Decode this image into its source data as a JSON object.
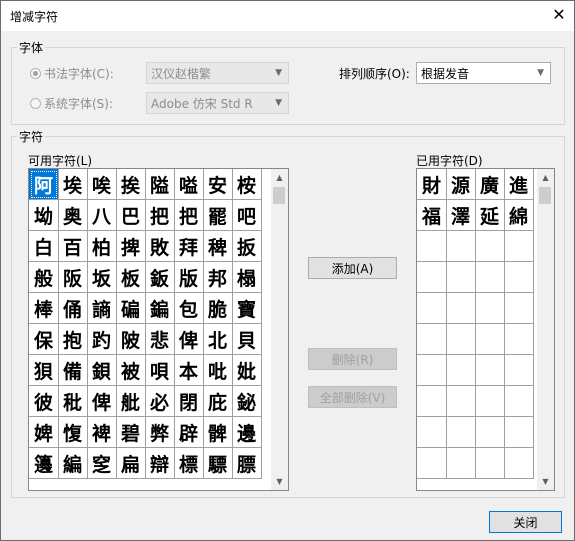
{
  "window": {
    "title": "增减字符",
    "close_icon": "close-icon"
  },
  "font_group": {
    "legend": "字体",
    "calligraphy_label": "书法字体(C):",
    "calligraphy_value": "汉仪赵楷繁",
    "system_label": "系统字体(S):",
    "system_value": "Adobe 仿宋 Std R",
    "sort_label": "排列顺序(O):",
    "sort_value": "根据发音"
  },
  "chars_group": {
    "legend": "字符",
    "available_label": "可用字符(L)",
    "used_label": "已用字符(D)",
    "available_chars": [
      "阿",
      "埃",
      "唉",
      "挨",
      "隘",
      "嗌",
      "安",
      "桉",
      "坳",
      "奥",
      "八",
      "巴",
      "把",
      "把",
      "罷",
      "吧",
      "白",
      "百",
      "柏",
      "捭",
      "敗",
      "拜",
      "稗",
      "扳",
      "般",
      "阪",
      "坂",
      "板",
      "鈑",
      "版",
      "邦",
      "榻",
      "棒",
      "俑",
      "謪",
      "碥",
      "鍽",
      "包",
      "脆",
      "寶",
      "保",
      "抱",
      "趵",
      "陂",
      "悲",
      "俾",
      "北",
      "貝",
      "狽",
      "備",
      "鋇",
      "被",
      "唄",
      "本",
      "吡",
      "妣",
      "彼",
      "秕",
      "俾",
      "舭",
      "必",
      "閉",
      "庇",
      "鉍",
      "婢",
      "愎",
      "裨",
      "碧",
      "弊",
      "辟",
      "髀",
      "邊",
      "籩",
      "編",
      "窆",
      "扁",
      "辯",
      "標",
      "驃",
      "膘"
    ],
    "used_chars": [
      "財",
      "源",
      "廣",
      "進",
      "福",
      "澤",
      "延",
      "綿"
    ],
    "used_rows": 10
  },
  "buttons": {
    "add": "添加(A)",
    "remove": "删除(R)",
    "remove_all": "全部删除(V)",
    "close": "关闭"
  }
}
